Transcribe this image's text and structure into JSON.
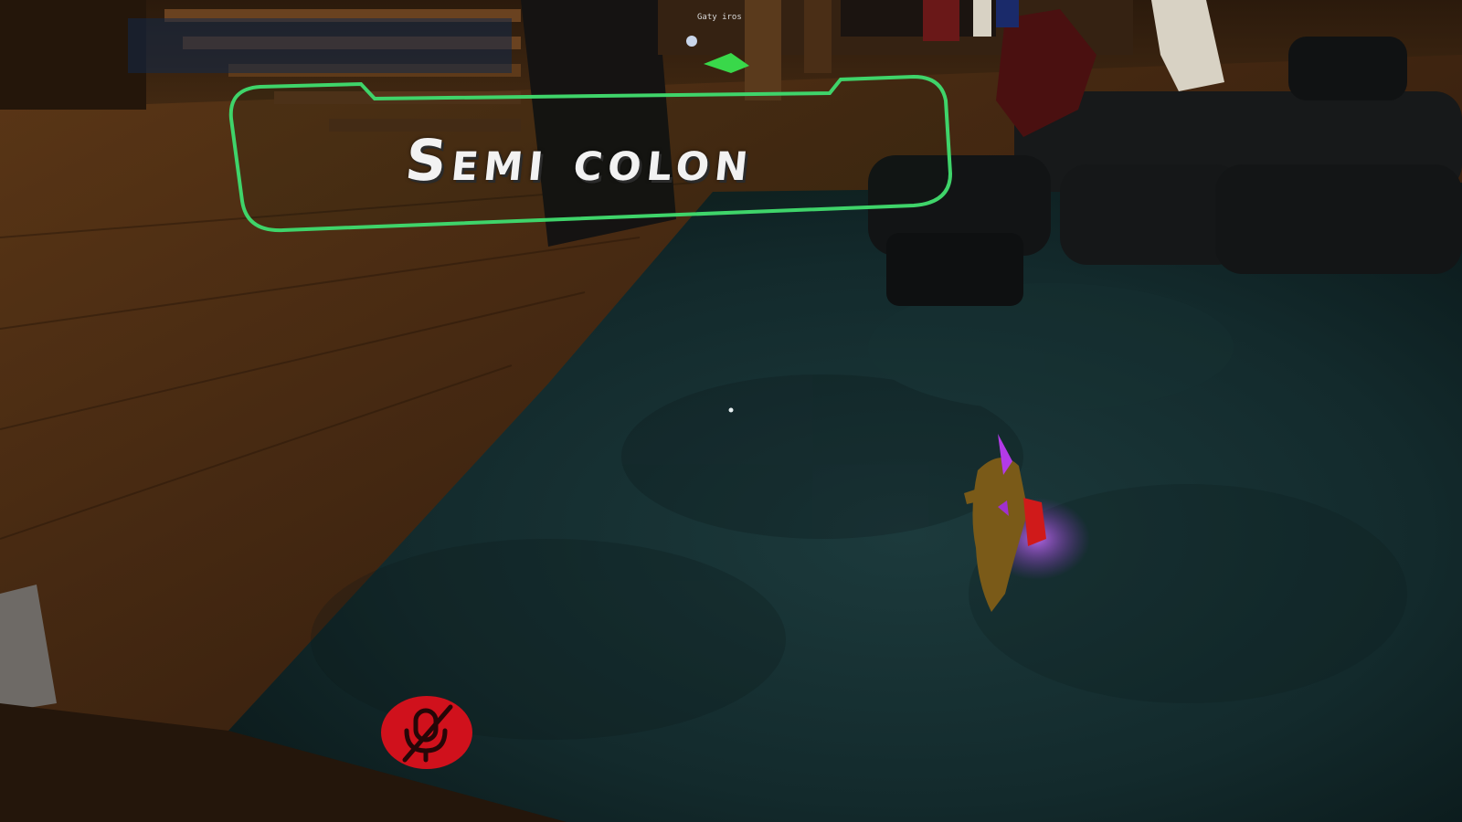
{
  "nameplate": {
    "player_name": "Semi colon",
    "border_color": "#3fd46a"
  },
  "remote_nameplate": {
    "text": "Gaty iros"
  },
  "status": {
    "mute_icon": "mic-muted-icon",
    "mute_color": "#d0111c"
  },
  "reticle": {
    "icon": "crosshair-dot-icon"
  }
}
